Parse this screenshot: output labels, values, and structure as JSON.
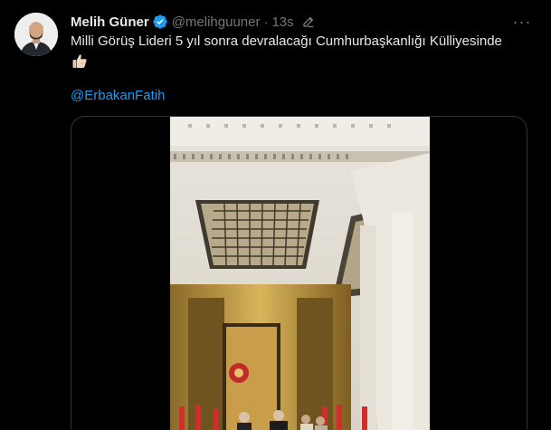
{
  "tweet": {
    "author": {
      "display_name": "Melih Güner",
      "handle": "@melihguuner",
      "verified": true
    },
    "separator": "·",
    "timestamp": "13s",
    "text": "Milli Görüş Lideri 5 yıl sonra devralacağı Cumhurbaşkanlığı Külliyesinde",
    "emoji": "thumbs-up",
    "mention": "@ErbakanFatih",
    "more_label": "···"
  },
  "icons": {
    "verified": "verified-badge-icon",
    "edit": "edit-pencil-icon",
    "more": "more-options-icon"
  },
  "colors": {
    "background": "#000000",
    "text_primary": "#e7e9ea",
    "text_secondary": "#71767b",
    "link": "#1d9bf0",
    "verified": "#1d9bf0",
    "border": "#2f3336"
  }
}
